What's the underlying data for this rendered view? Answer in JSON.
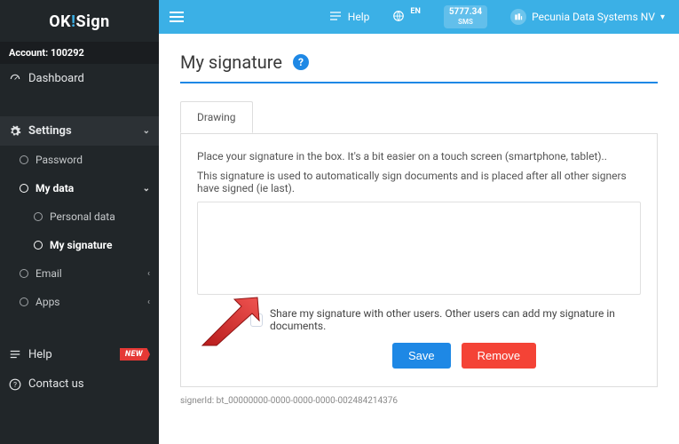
{
  "brand": {
    "part1": "OK",
    "part2": "!",
    "part3": "Sign"
  },
  "sidebar": {
    "account_label": "Account: 100292",
    "items": {
      "dashboard": "Dashboard",
      "settings": "Settings",
      "password": "Password",
      "mydata": "My data",
      "personal": "Personal data",
      "mysignature": "My signature",
      "email": "Email",
      "apps": "Apps",
      "help": "Help",
      "new_badge": "NEW",
      "contact": "Contact us"
    }
  },
  "topbar": {
    "help": "Help",
    "lang": "EN",
    "sms_count": "5777.34",
    "sms_label": "SMS",
    "org_name": "Pecunia Data Systems NV"
  },
  "page": {
    "title": "My signature",
    "tab_drawing": "Drawing",
    "hint1": "Place your signature in the box. It's a bit easier on a touch screen (smartphone, tablet)..",
    "hint2": "This signature is used to automatically sign documents and is placed after all other signers have signed (ie last).",
    "share_label": "Share my signature with other users. Other users can add my signature in documents.",
    "save": "Save",
    "remove": "Remove",
    "signer_id": "signerId: bt_00000000-0000-0000-0000-002484214376"
  }
}
